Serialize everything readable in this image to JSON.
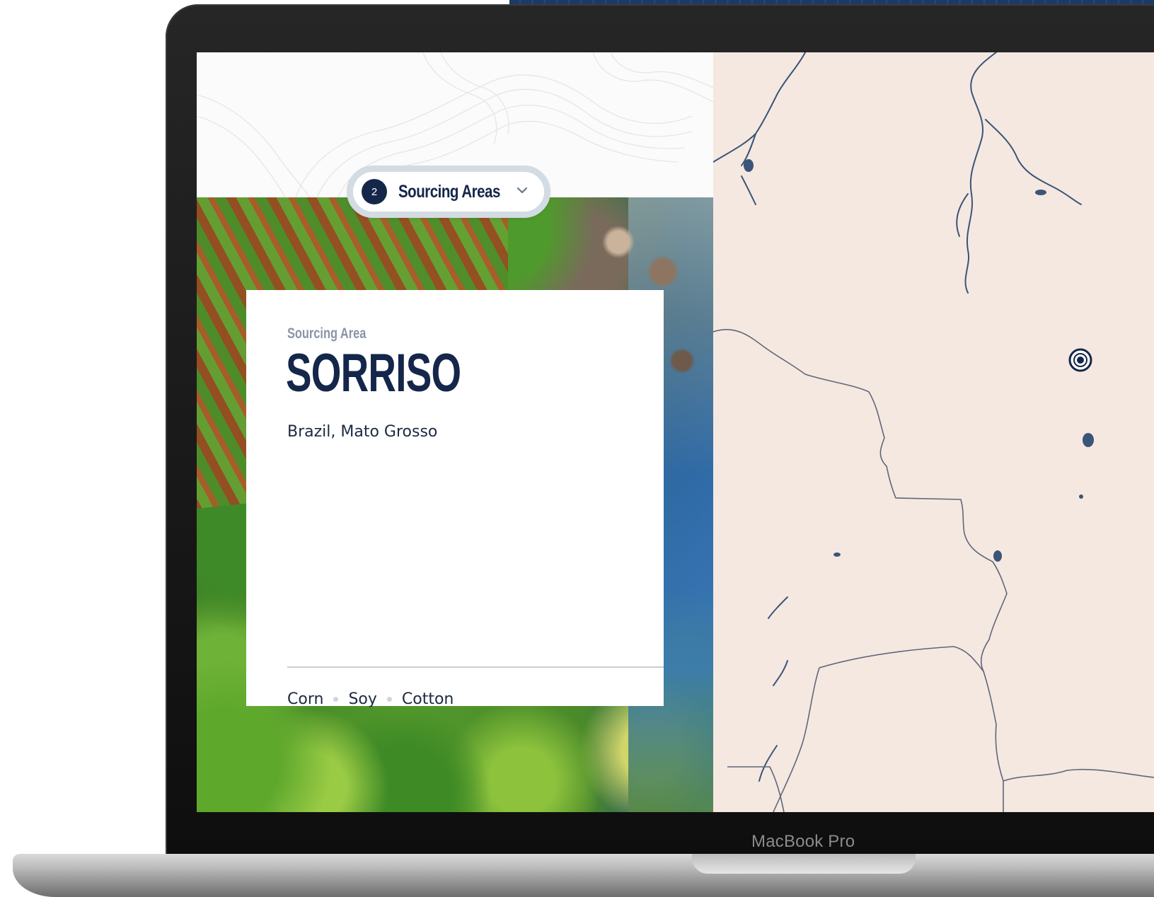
{
  "device": {
    "label": "MacBook Pro"
  },
  "sourcing_selector": {
    "count": "2",
    "label": "Sourcing Areas",
    "icon": "chevron-down-icon"
  },
  "area_card": {
    "eyebrow": "Sourcing Area",
    "title": "SORRISO",
    "location": "Brazil, Mato Grosso",
    "crops": [
      "Corn",
      "Soy",
      "Cotton"
    ]
  },
  "map": {
    "marker_icon": "location-target-icon",
    "land_color": "#f5e8e1",
    "water_color": "#3a5577"
  },
  "colors": {
    "navy": "#14264a",
    "muted_label": "#8a95a6",
    "pill_border": "#d3dbe3"
  }
}
